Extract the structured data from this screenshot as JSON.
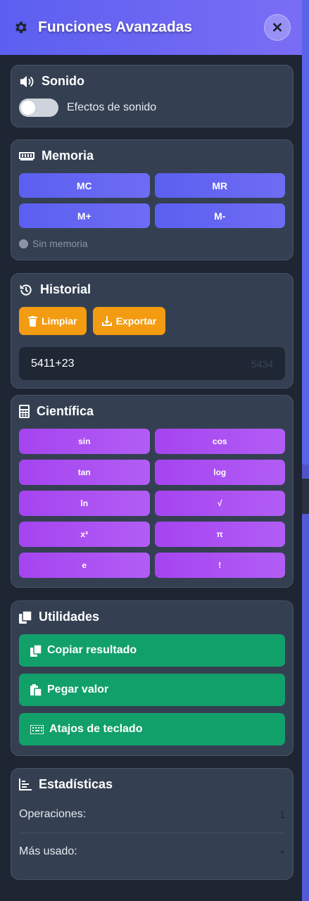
{
  "header": {
    "title": "Funciones Avanzadas",
    "close_label": "✕"
  },
  "sound": {
    "title": "Sonido",
    "toggle_label": "Efectos de sonido",
    "enabled": false
  },
  "memory": {
    "title": "Memoria",
    "buttons": [
      "MC",
      "MR",
      "M+",
      "M-"
    ],
    "status": "Sin memoria"
  },
  "history": {
    "title": "Historial",
    "clear_label": "Limpiar",
    "export_label": "Exportar",
    "entries": [
      {
        "expression": "5411+23",
        "result": "5434"
      }
    ]
  },
  "scientific": {
    "title": "Científica",
    "buttons": [
      "sin",
      "cos",
      "tan",
      "log",
      "ln",
      "√",
      "x²",
      "π",
      "e",
      "!"
    ]
  },
  "utilities": {
    "title": "Utilidades",
    "copy_label": "Copiar resultado",
    "paste_label": "Pegar valor",
    "shortcuts_label": "Atajos de teclado"
  },
  "stats": {
    "title": "Estadísticas",
    "operations_label": "Operaciones:",
    "operations_value": "1",
    "most_used_label": "Más usado:",
    "most_used_value": "+"
  },
  "colors": {
    "header_gradient_start": "#5b5ff0",
    "memory_button": "#5b5ff0",
    "orange": "#f39c12",
    "scientific": "#a544f0",
    "green": "#12a06a",
    "card": "#344052",
    "background": "#1e2533"
  }
}
